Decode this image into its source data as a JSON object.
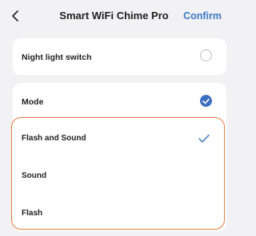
{
  "header": {
    "title": "Smart WiFi Chime Pro",
    "confirm_label": "Confirm",
    "back_icon": "chevron-left-icon"
  },
  "night_light": {
    "label": "Night light switch",
    "selected": false
  },
  "mode": {
    "label": "Mode",
    "selected": true,
    "options": [
      {
        "label": "Flash and Sound",
        "selected": true
      },
      {
        "label": "Sound",
        "selected": false
      },
      {
        "label": "Flash",
        "selected": false
      }
    ]
  },
  "colors": {
    "accent": "#3d79c4",
    "highlight_border": "#e87a3e",
    "background": "#f2f2f4"
  }
}
